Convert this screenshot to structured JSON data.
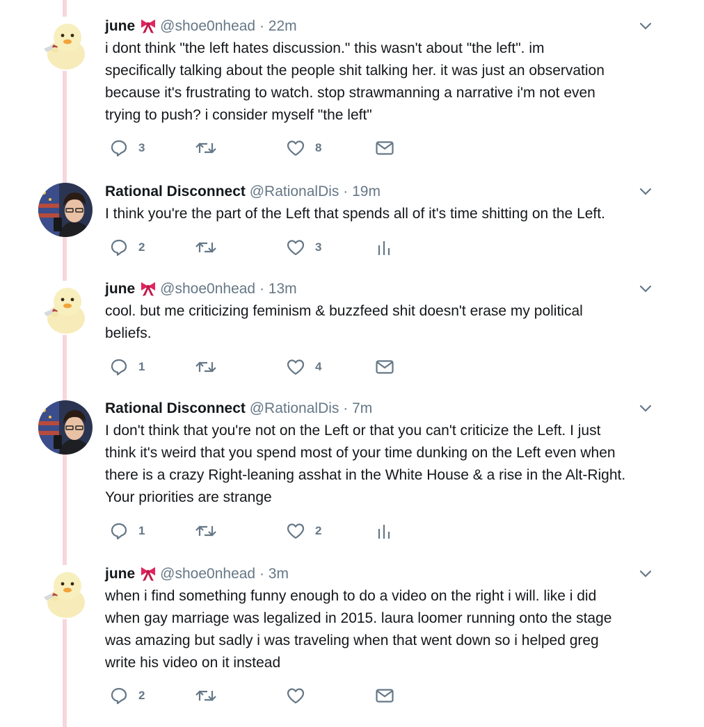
{
  "tweets": [
    {
      "name": "june",
      "has_bow": true,
      "handle": "@shoe0nhead",
      "separator": "·",
      "time": "22m",
      "lines": [
        "i dont think \"the left hates discussion.\" this wasn't about \"the left\". im",
        "specifically talking about the people shit talking her. it was just an observation",
        "because it's frustrating to watch. stop strawmanning a narrative i'm not even",
        "trying to push? i consider myself \"the left\""
      ],
      "replies": "3",
      "retweets": "",
      "likes": "8",
      "last_action": "mail-icon"
    },
    {
      "name": "Rational Disconnect",
      "has_bow": false,
      "handle": "@RationalDis",
      "separator": "·",
      "time": "19m",
      "lines": [
        "I think you're the part of the Left that spends all of it's time shitting on the Left."
      ],
      "replies": "2",
      "retweets": "",
      "likes": "3",
      "last_action": "analytics-icon"
    },
    {
      "name": "june",
      "has_bow": true,
      "handle": "@shoe0nhead",
      "separator": "·",
      "time": "13m",
      "lines": [
        "cool. but me criticizing feminism & buzzfeed shit doesn't erase my political",
        "beliefs."
      ],
      "replies": "1",
      "retweets": "",
      "likes": "4",
      "last_action": "mail-icon"
    },
    {
      "name": "Rational Disconnect",
      "has_bow": false,
      "handle": "@RationalDis",
      "separator": "·",
      "time": "7m",
      "lines": [
        "I don't think that you're not on the Left or that you can't criticize the Left. I just",
        "think it's weird that you spend most of your time dunking on the Left even when",
        "there is a crazy Right-leaning asshat in the White House & a rise in the Alt-Right.",
        "Your priorities are strange"
      ],
      "replies": "1",
      "retweets": "",
      "likes": "2",
      "last_action": "analytics-icon"
    },
    {
      "name": "june",
      "has_bow": true,
      "handle": "@shoe0nhead",
      "separator": "·",
      "time": "3m",
      "lines": [
        "when i find something funny enough to do a video on the right i will. like i did",
        "when gay marriage was legalized in 2015. laura loomer running onto the stage",
        "was amazing but sadly i was traveling when that went down so i helped greg",
        "write his video on it instead"
      ],
      "replies": "2",
      "retweets": "",
      "likes": "",
      "last_action": "mail-icon"
    }
  ],
  "colors": {
    "thread_line": "#f6d7dc",
    "text": "#14171a",
    "muted": "#657786",
    "bow": "#e0245e"
  },
  "icons": [
    "reply-icon",
    "retweet-icon",
    "like-icon",
    "mail-icon",
    "analytics-icon",
    "caret-down-icon",
    "bow-emoji-icon"
  ]
}
